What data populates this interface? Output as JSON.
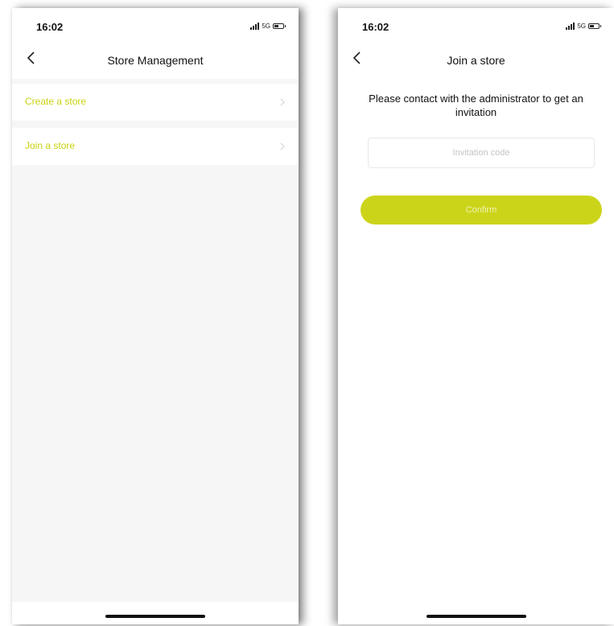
{
  "colors": {
    "accent": "#ccd41a",
    "accent_text": "#c8d20f",
    "button_text": "#eef3b0"
  },
  "left_screen": {
    "status_bar": {
      "time": "16:02",
      "network": "5G"
    },
    "nav": {
      "title": "Store Management",
      "back_icon": "chevron-left-icon"
    },
    "items": [
      {
        "label": "Create a store",
        "icon": "chevron-right-icon"
      },
      {
        "label": "Join a store",
        "icon": "chevron-right-icon"
      }
    ]
  },
  "right_screen": {
    "status_bar": {
      "time": "16:02",
      "network": "5G"
    },
    "nav": {
      "title": "Join a store",
      "back_icon": "chevron-left-icon"
    },
    "instruction": "Please contact with the administrator to get an invitation",
    "invitation_input": {
      "value": "",
      "placeholder": "Invitation code"
    },
    "confirm_label": "Confirm"
  }
}
